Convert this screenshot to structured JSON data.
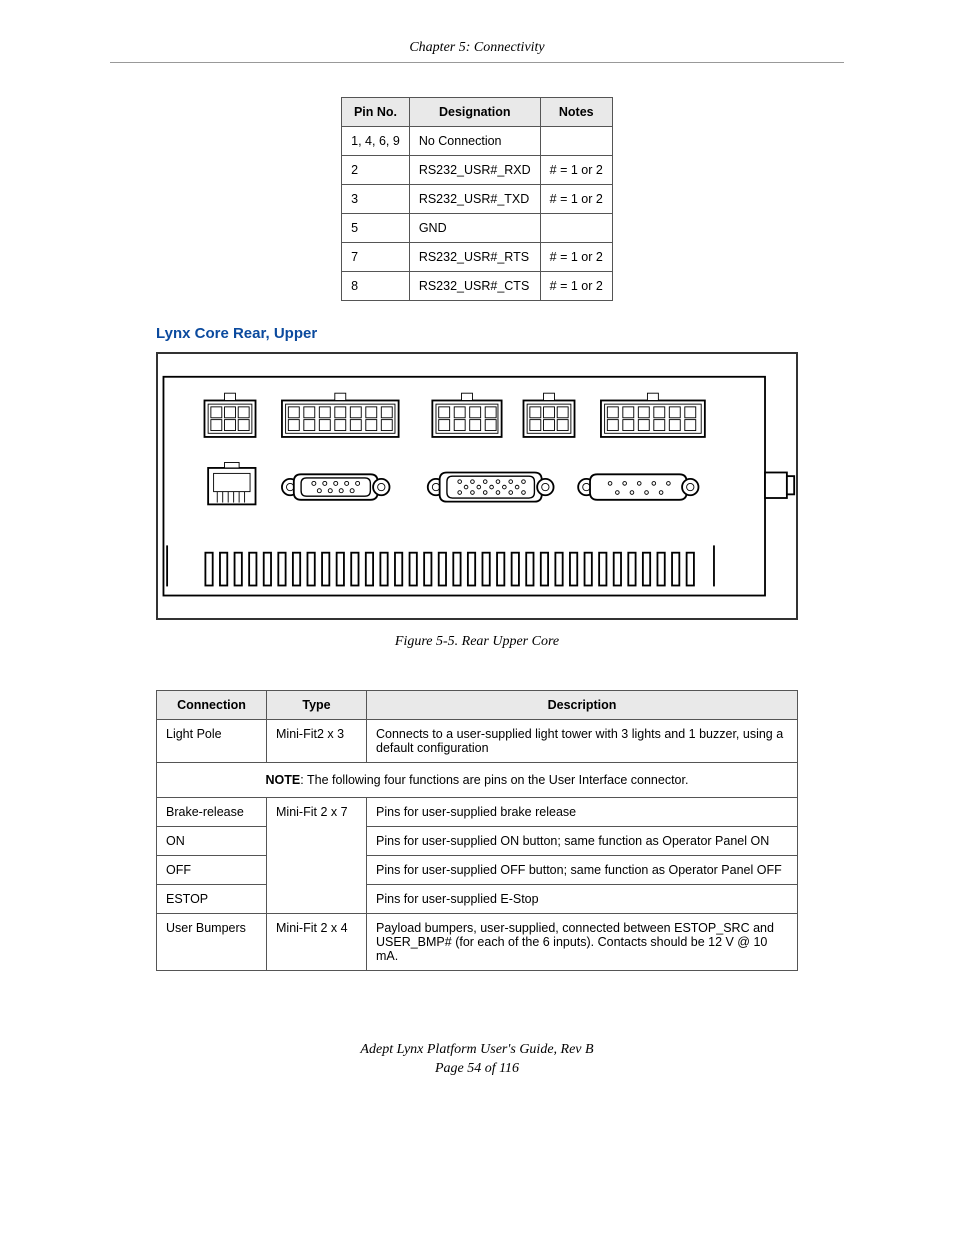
{
  "header": {
    "chapter": "Chapter 5: Connectivity"
  },
  "pin_table": {
    "headers": {
      "pin": "Pin No.",
      "designation": "Designation",
      "notes": "Notes"
    },
    "rows": [
      {
        "pin": "1, 4, 6, 9",
        "designation": "No Connection",
        "notes": ""
      },
      {
        "pin": "2",
        "designation": "RS232_USR#_RXD",
        "notes": "# = 1 or 2"
      },
      {
        "pin": "3",
        "designation": "RS232_USR#_TXD",
        "notes": "# = 1 or 2"
      },
      {
        "pin": "5",
        "designation": "GND",
        "notes": ""
      },
      {
        "pin": "7",
        "designation": "RS232_USR#_RTS",
        "notes": "# = 1 or 2"
      },
      {
        "pin": "8",
        "designation": "RS232_USR#_CTS",
        "notes": "# = 1 or 2"
      }
    ]
  },
  "section_heading": "Lynx Core Rear, Upper",
  "figure_caption": "Figure 5-5. Rear Upper Core",
  "conn_table": {
    "headers": {
      "connection": "Connection",
      "type": "Type",
      "description": "Description"
    },
    "rows": [
      {
        "connection": "Light Pole",
        "type": "Mini-Fit2 x 3",
        "description": "Connects to a user-supplied light tower with 3 lights and 1 buzzer, using a default configuration"
      }
    ],
    "note_prefix": "NOTE",
    "note_text": ": The following four functions are pins on the User Interface connector.",
    "group_rows": [
      {
        "connection": "Brake-release",
        "type": "Mini-Fit 2 x 7",
        "description": "Pins for user-supplied brake release"
      },
      {
        "connection": "ON",
        "description": "Pins for user-supplied ON button; same function as Operator Panel ON"
      },
      {
        "connection": "OFF",
        "description": "Pins for user-supplied OFF button; same function as Operator Panel OFF"
      },
      {
        "connection": "ESTOP",
        "description": "Pins for user-supplied E-Stop"
      }
    ],
    "last_row": {
      "connection": "User Bumpers",
      "type": "Mini-Fit 2 x 4",
      "description": "Payload bumpers, user-supplied, connected between ESTOP_SRC and USER_BMP# (for each of the 6 inputs). Contacts should be 12 V @ 10 mA."
    }
  },
  "footer": {
    "line1": "Adept Lynx Platform User's Guide, Rev B",
    "line2": "Page 54 of 116"
  }
}
